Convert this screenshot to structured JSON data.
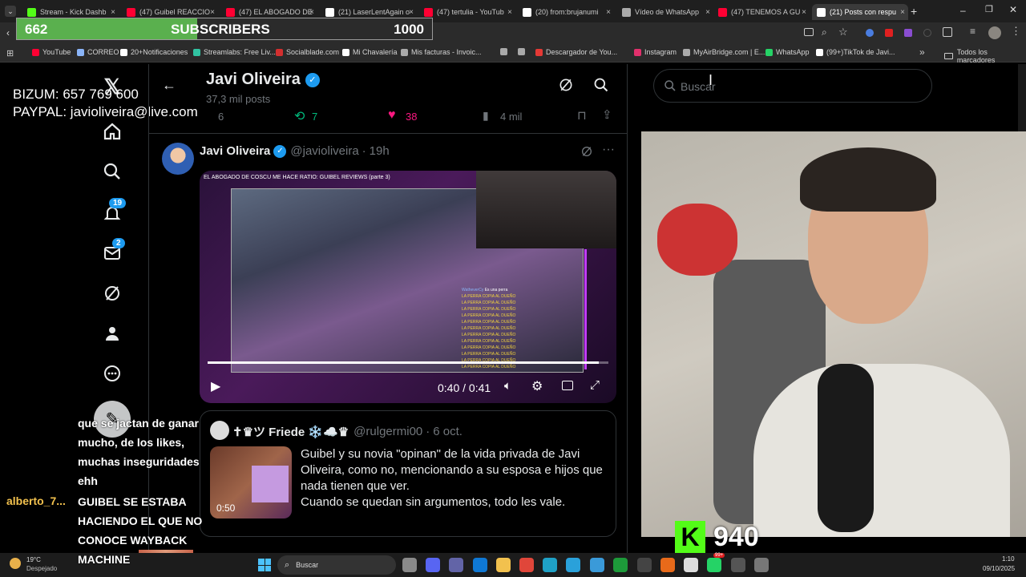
{
  "browser": {
    "tabs": [
      {
        "label": "Stream - Kick Dashb",
        "color": "#53fc18"
      },
      {
        "label": "(47) Guibel REACCIO",
        "color": "#ff0033"
      },
      {
        "label": "(47) EL ABOGADO DE",
        "color": "#ff0033"
      },
      {
        "label": "(21) LaserLentAgain o",
        "color": "#ffffff"
      },
      {
        "label": "(47) tertulia - YouTub",
        "color": "#ff0033"
      },
      {
        "label": "(20) from:brujanumi",
        "color": "#ffffff"
      },
      {
        "label": "Vídeo de WhatsApp",
        "color": "#aaaaaa"
      },
      {
        "label": "(47) TENEMOS A GU",
        "color": "#ff0033"
      },
      {
        "label": "(21) Posts con respu",
        "color": "#ffffff"
      }
    ],
    "bookmarks": [
      {
        "label": "YouTube",
        "color": "#ff0033"
      },
      {
        "label": "CORREO",
        "color": "#8ab4f8"
      },
      {
        "label": "20+Notificaciones",
        "color": "#ffffff"
      },
      {
        "label": "Streamlabs: Free Liv...",
        "color": "#31c3a2"
      },
      {
        "label": "Socialblade.com",
        "color": "#d32f2f"
      },
      {
        "label": "Mi Chavalería",
        "color": "#ffffff"
      },
      {
        "label": "Mis facturas - Invoic...",
        "color": "#aaaaaa"
      },
      {
        "label": "",
        "color": "#aaaaaa"
      },
      {
        "label": "",
        "color": "#aaaaaa"
      },
      {
        "label": "Descargador de You...",
        "color": "#e53935"
      },
      {
        "label": "Instagram",
        "color": "#e1306c"
      },
      {
        "label": "MyAirBridge.com | E...",
        "color": "#aaaaaa"
      },
      {
        "label": "WhatsApp",
        "color": "#25d366"
      },
      {
        "label": "(99+)TikTok de Javi...",
        "color": "#ffffff"
      }
    ],
    "bookmarks_folder": "Todos los marcadores",
    "overflow": "»"
  },
  "overlay": {
    "subs_current": "662",
    "subs_label": "SUBSCRIBERS",
    "subs_goal": "1000",
    "subs_progress": 0.662,
    "donate_bizum": "BIZUM: 657 769 600",
    "donate_paypal": "PAYPAL: javioliveira@live.com",
    "kick_count": "940"
  },
  "x": {
    "profile_name": "Javi Oliveira",
    "posts_count": "37,3 mil posts",
    "search_placeholder": "Buscar",
    "notif_badge": "19",
    "msg_badge": "2",
    "prev_actions": {
      "replies": "6",
      "reposts": "7",
      "likes": "38",
      "views": "4 mil"
    },
    "tweet": {
      "author": "Javi Oliveira",
      "handle": "@javioliveira",
      "sep": "·",
      "time": "19h",
      "video_title": "EL ABOGADO DE COSCU ME HACE RATIO: GUIBEL REVIEWS (parte 3)",
      "video_time": "0:40 / 0:41",
      "chat_tag": "WatheverCy",
      "chat_snip": "Es una perra",
      "chat_line": "LA PERRA COPIA AL DUEÑO"
    },
    "quoted": {
      "author": "✝︎♛ツ Friede ❄️☁️♛",
      "handle": "@rulgermi00",
      "sep": "·",
      "date": "6 oct.",
      "thumb_time": "0:50",
      "text_1": "Guibel y su novia \"opinan\" de la vida privada de Javi",
      "text_2": "Oliveira, como no, mencionando a su esposa e hijos que",
      "text_3": "nada tienen que ver.",
      "text_4": "Cuando se quedan sin argumentos, todo les vale."
    }
  },
  "chat": {
    "lines": [
      "que se jactan de ganar",
      "mucho, de los likes,",
      "muchas inseguridades",
      "ehh"
    ],
    "user": "alberto_7...",
    "user_color": "#f2c14e",
    "msg": [
      "GUIBEL SE ESTABA",
      "HACIENDO EL QUE NO",
      "CONOCE WAYBACK",
      "MACHINE"
    ]
  },
  "taskbar": {
    "weather_temp": "19°C",
    "weather_desc": "Despejado",
    "search": "Buscar",
    "time": "1:10",
    "date": "09/10/2025",
    "whatsapp_badge": "99+"
  },
  "colors": {
    "accent": "#1d9bf0",
    "like": "#f91880",
    "repost": "#00ba7c",
    "kick": "#53fc18"
  }
}
